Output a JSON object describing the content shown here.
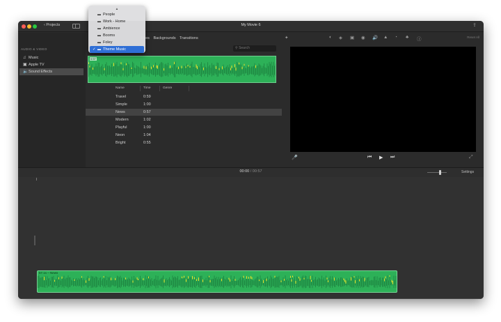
{
  "window": {
    "title": "My Movie 6",
    "projects_label": "Projects",
    "share_icon": "share-icon"
  },
  "sidebar": {
    "header": "AUDIO & VIDEO",
    "items": [
      {
        "label": "Music",
        "icon": "music-icon",
        "selected": false
      },
      {
        "label": "Apple TV",
        "icon": "tv-icon",
        "selected": false
      },
      {
        "label": "Sound Effects",
        "icon": "speaker-icon",
        "selected": true
      }
    ]
  },
  "browser": {
    "tabs": [
      "Titles",
      "Backgrounds",
      "Transitions"
    ],
    "search_placeholder": "Search",
    "preview_clip_label": "0:57",
    "columns": [
      "Name",
      "Time",
      "Genre"
    ],
    "rows": [
      {
        "name": "Travel",
        "time": "0:59",
        "selected": false
      },
      {
        "name": "Simple",
        "time": "1:00",
        "selected": false
      },
      {
        "name": "News",
        "time": "0:57",
        "selected": true
      },
      {
        "name": "Modern",
        "time": "1:02",
        "selected": false
      },
      {
        "name": "Playful",
        "time": "1:00",
        "selected": false
      },
      {
        "name": "Neon",
        "time": "1:04",
        "selected": false
      },
      {
        "name": "Bright",
        "time": "0:55",
        "selected": false
      }
    ]
  },
  "dropdown": {
    "items": [
      {
        "label": "People",
        "checked": false,
        "selected": false
      },
      {
        "label": "Work - Home",
        "checked": false,
        "selected": false
      },
      {
        "label": "Ambience",
        "checked": false,
        "selected": false
      },
      {
        "label": "Booms",
        "checked": false,
        "selected": false
      },
      {
        "label": "Foley",
        "checked": false,
        "selected": false
      },
      {
        "label": "Theme Music",
        "checked": true,
        "selected": true
      }
    ]
  },
  "viewer": {
    "tool_icons": [
      "magic-wand-icon",
      "color-balance-icon",
      "color-correction-icon",
      "crop-icon",
      "stabilization-icon",
      "volume-icon",
      "noise-reduction-icon",
      "speed-icon",
      "clip-filter-icon",
      "info-icon"
    ],
    "reset_all": "Reset All"
  },
  "timeline": {
    "current_time": "00:00",
    "total_time": "00:57",
    "settings_label": "Settings",
    "clip_label": "57.1s – News"
  },
  "colors": {
    "accent": "#2f6fd6",
    "audio_clip": "#2db158",
    "waveform_peak": "#e8e02a"
  }
}
